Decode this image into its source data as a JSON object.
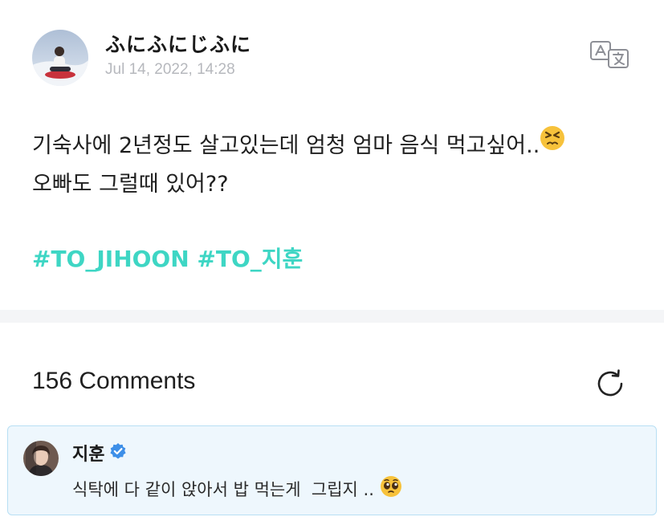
{
  "post": {
    "author": "ふにふにじふに",
    "timestamp": "Jul 14, 2022, 14:28",
    "body_line1": "기숙사에 2년정도 살고있는데 엄청 엄마 음식 먹고싶어..",
    "body_line2": "오빠도 그럴때 있어??",
    "body_emoji": "persevering-face-emoji",
    "hashtags": [
      "#TO_JIHOON",
      "#TO_지훈"
    ],
    "translate_icon": "translate-icon"
  },
  "comments": {
    "count_label": "156 Comments",
    "refresh_icon": "refresh-icon"
  },
  "comment": {
    "author": "지훈",
    "verified_icon": "verified-badge-icon",
    "text": "식탁에 다 같이 앉아서 밥 먹는게  그립지 .. ",
    "emoji": "pleading-face-emoji"
  },
  "colors": {
    "hashtag": "#3ed6c4",
    "timestamp": "#b6b8bd",
    "divider": "#f4f5f7",
    "comment_bg": "#eef7fd",
    "comment_border": "#b8dff4",
    "verified": "#3d8fe8"
  }
}
